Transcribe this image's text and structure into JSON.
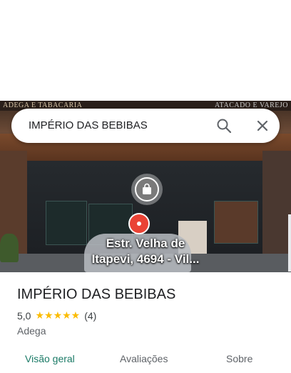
{
  "photo": {
    "sign_left": "ADEGA E TABACARIA",
    "sign_right": "ATACADO E VAREJO"
  },
  "search": {
    "query": "IMPÉRIO DAS BEBIBAS",
    "search_icon": "search-icon",
    "close_icon": "close-icon"
  },
  "map": {
    "street_label_line1": "Estr. Velha de",
    "street_label_line2": "Itapevi, 4694 - Vil..."
  },
  "place": {
    "title": "IMPÉRIO DAS BEBIBAS",
    "rating": "5,0",
    "stars": "★★★★★",
    "review_count": "(4)",
    "category": "Adega"
  },
  "tabs": [
    {
      "label": "Visão geral",
      "active": true
    },
    {
      "label": "Avaliações",
      "active": false
    },
    {
      "label": "Sobre",
      "active": false
    }
  ],
  "colors": {
    "accent": "#1a7a66",
    "star": "#fbbc04",
    "pin": "#ea4335"
  }
}
